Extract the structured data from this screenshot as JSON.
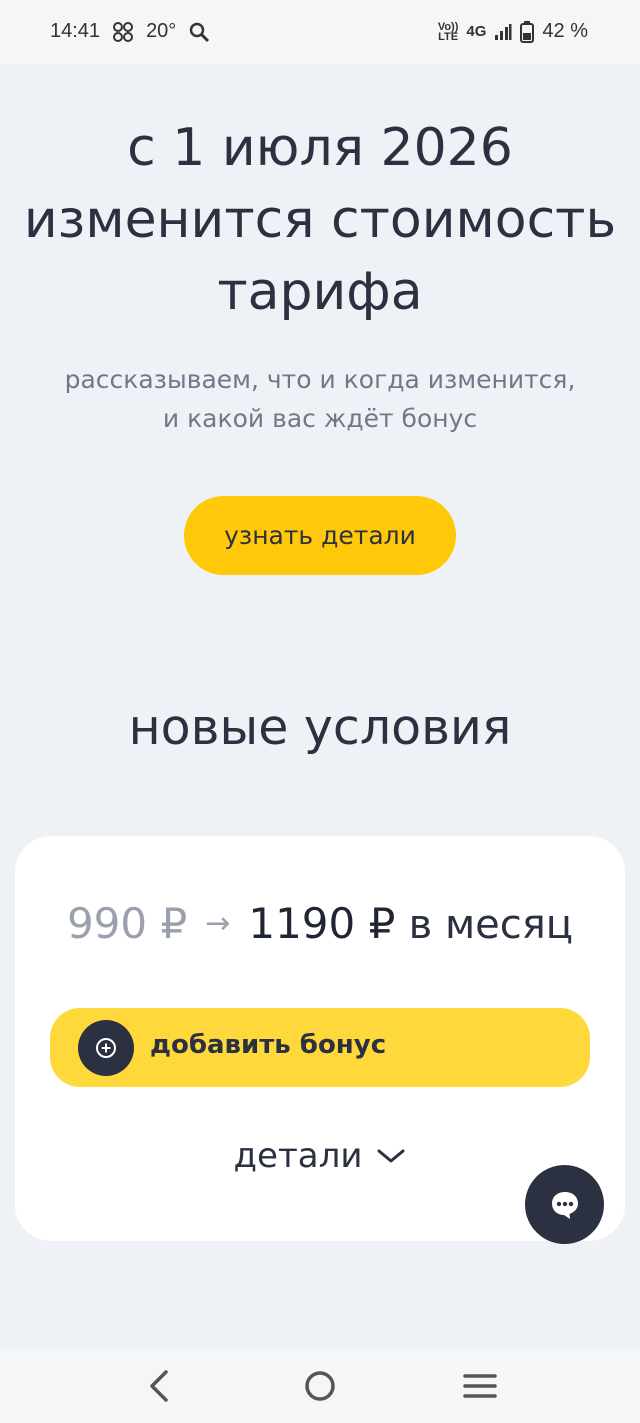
{
  "status_bar": {
    "time": "14:41",
    "temperature": "20°",
    "volte_top": "Vo))",
    "volte_bottom": "LTE",
    "network": "4G",
    "battery": "42 %",
    "icons": [
      "pinwheel-icon",
      "search-icon",
      "volte-icon",
      "signal-icon",
      "battery-icon"
    ]
  },
  "hero": {
    "title_line1": "с 1 июля 2026",
    "title_line2": "изменится стоимость",
    "title_line3": "тарифа",
    "subtitle_line1": "рассказываем, что и когда изменится,",
    "subtitle_line2": "и какой вас ждёт бонус",
    "cta_label": "узнать детали"
  },
  "conditions": {
    "section_title": "новые условия",
    "old_price": "990 ₽",
    "arrow": "→",
    "new_price": "1190 ₽",
    "per_month": "в месяц",
    "bonus_label": "добавить бонус",
    "details_label": "детали"
  },
  "nav": {
    "icons": [
      "back-icon",
      "home-icon",
      "menu-icon"
    ]
  },
  "colors": {
    "accent": "#ffc809",
    "bonus": "#ffd83c",
    "dark": "#2b3140",
    "background": "#eef2f6"
  }
}
